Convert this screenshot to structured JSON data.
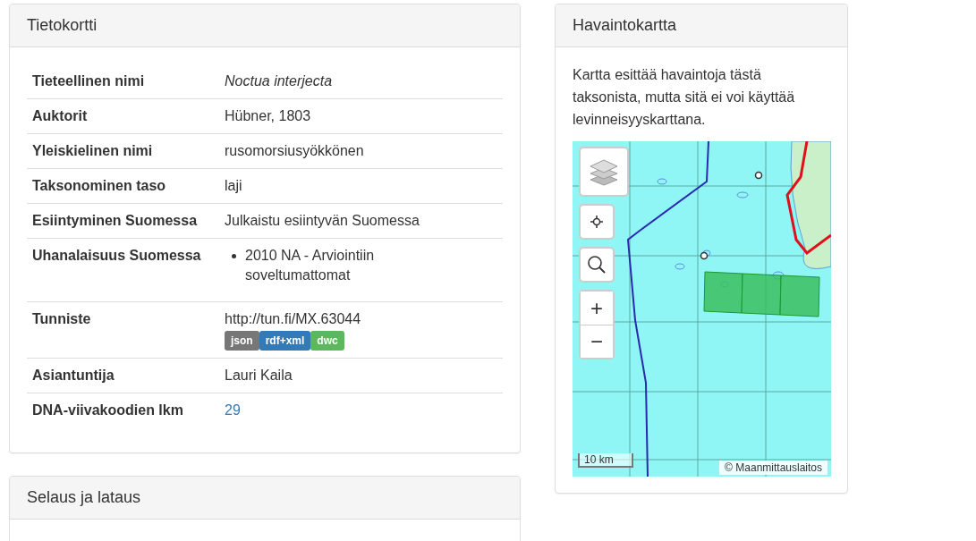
{
  "info_card": {
    "title": "Tietokortti",
    "rows": [
      {
        "kind": "italic",
        "label": "Tieteellinen nimi",
        "value": "Noctua interjecta"
      },
      {
        "kind": "text",
        "label": "Auktorit",
        "value": "Hübner, 1803"
      },
      {
        "kind": "text",
        "label": "Yleiskielinen nimi",
        "value": "rusomorsiusyökkönen"
      },
      {
        "kind": "text",
        "label": "Taksonominen taso",
        "value": "laji"
      },
      {
        "kind": "text",
        "label": "Esiintyminen Suomessa",
        "value": "Julkaistu esiintyvän Suomessa"
      },
      {
        "kind": "list",
        "label": "Uhanalaisuus Suomessa",
        "items": [
          "2010 NA - Arviointiin soveltumattomat"
        ]
      },
      {
        "kind": "identifier",
        "label": "Tunniste",
        "value": "http://tun.fi/MX.63044",
        "badges": [
          {
            "label": "json",
            "color": "#777777"
          },
          {
            "label": "rdf+xml",
            "color": "#337ab7"
          },
          {
            "label": "dwc",
            "color": "#5cb85c"
          }
        ]
      },
      {
        "kind": "text",
        "label": "Asiantuntija",
        "value": "Lauri Kaila"
      },
      {
        "kind": "link",
        "label": "DNA-viivakoodien lkm",
        "value": "29"
      }
    ]
  },
  "browse_panel": {
    "title": "Selaus ja lataus"
  },
  "map_panel": {
    "title": "Havaintokartta",
    "description": "Kartta esittää havaintoja tästä taksonista, mutta sitä ei voi käyttää levinneisyyskarttana.",
    "zoom_in": "+",
    "zoom_out": "−",
    "scale": "10 km",
    "attribution": "© Maanmittauslaitos"
  }
}
